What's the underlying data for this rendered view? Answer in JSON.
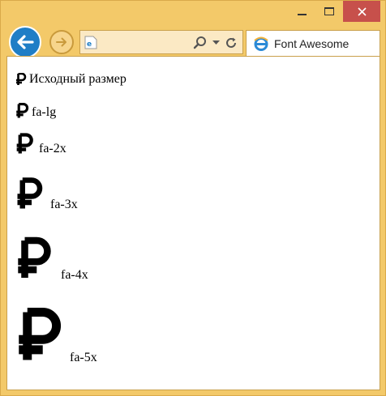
{
  "browser": {
    "tab_title": "Font Awesome",
    "controls": {
      "minimize": "minimize",
      "maximize": "maximize",
      "close": "close"
    }
  },
  "page": {
    "rows": [
      {
        "label": "Исходный размер"
      },
      {
        "label": "fa-lg"
      },
      {
        "label": "fa-2x"
      },
      {
        "label": "fa-3x"
      },
      {
        "label": "fa-4x"
      },
      {
        "label": "fa-5x"
      }
    ]
  },
  "colors": {
    "accent": "#1f7ec6",
    "frame": "#f3c969",
    "close": "#c7504b"
  }
}
